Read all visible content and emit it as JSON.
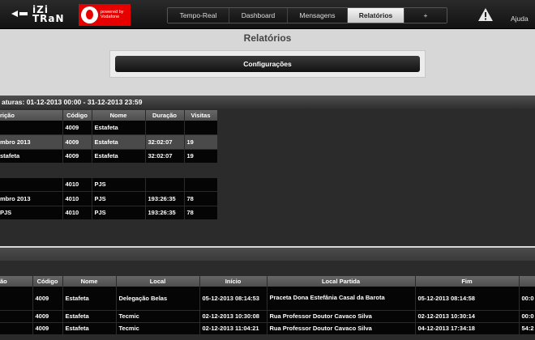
{
  "header": {
    "logo_line1": "iZi",
    "logo_line2": "TRaN",
    "vodafone_text": "powered by Vodafone",
    "tabs": [
      {
        "label": "Tempo-Real",
        "active": false
      },
      {
        "label": "Dashboard",
        "active": false
      },
      {
        "label": "Mensagens",
        "active": false
      },
      {
        "label": "Relatórios",
        "active": true
      },
      {
        "label": "+",
        "active": false
      }
    ],
    "help": "Ajuda"
  },
  "page_title": "Relatórios",
  "config_button": "Configurações",
  "summary": {
    "title": "aturas: 01-12-2013 00:00 - 31-12-2013 23:59",
    "columns": [
      "rição",
      "Código",
      "Nome",
      "Duração",
      "Visitas"
    ],
    "rows": [
      [
        "",
        "4009",
        "Estafeta",
        "",
        ""
      ],
      [
        "mbro 2013",
        "4009",
        "Estafeta",
        "32:02:07",
        "19"
      ],
      [
        "stafeta",
        "4009",
        "Estafeta",
        "32:02:07",
        "19"
      ],
      [
        "",
        "",
        "",
        "",
        ""
      ],
      [
        "",
        "4010",
        "PJS",
        "",
        ""
      ],
      [
        "mbro 2013",
        "4010",
        "PJS",
        "193:26:35",
        "78"
      ],
      [
        "PJS",
        "4010",
        "PJS",
        "193:26:35",
        "78"
      ],
      [
        "",
        "",
        "",
        "",
        ""
      ]
    ]
  },
  "details": {
    "columns": [
      "ão",
      "Código",
      "Nome",
      "Local",
      "Início",
      "Local Partida",
      "Fim",
      ""
    ],
    "rows": [
      [
        "",
        "4009",
        "Estafeta",
        "Delegação Belas",
        "05-12-2013 08:14:53",
        "Praceta Dona Estefânia Casal da Barota",
        "05-12-2013 08:14:58",
        "00:0"
      ],
      [
        "",
        "4009",
        "Estafeta",
        "Tecmic",
        "02-12-2013 10:30:08",
        "Rua Professor Doutor Cavaco Silva",
        "02-12-2013 10:30:14",
        "00:0"
      ],
      [
        "",
        "4009",
        "Estafeta",
        "Tecmic",
        "02-12-2013 11:04:21",
        "Rua Professor Doutor Cavaco Silva",
        "04-12-2013 17:34:18",
        "54:2"
      ]
    ]
  },
  "colors": {
    "accent": "#e60000",
    "panel": "#2b2b2b",
    "row": "#050505",
    "selected_row": "#4a4a4a"
  }
}
